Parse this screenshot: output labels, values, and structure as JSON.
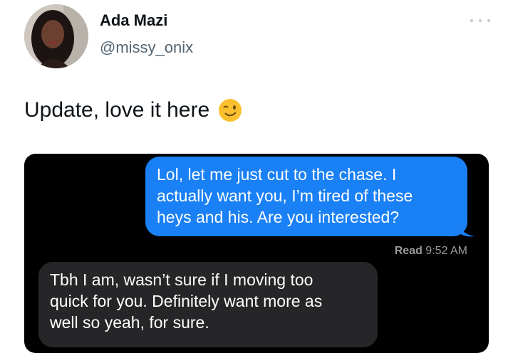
{
  "author": {
    "display_name": "Ada Mazi",
    "handle": "@missy_onix"
  },
  "tweet": {
    "text": "Update, love it here",
    "emoji": "winking-face"
  },
  "conversation": {
    "sent_message": {
      "lines": [
        "Lol, let me just cut to the chase. I",
        "actually want you, I’m tired of these",
        "heys and his. Are you interested?"
      ],
      "color": "#1a80f5"
    },
    "read_receipt": {
      "label": "Read",
      "time": "9:52 AM"
    },
    "received_message": {
      "lines": [
        "Tbh I am, wasn’t sure if I moving too",
        "quick for you. Definitely want more as",
        "well so yeah, for sure."
      ],
      "color": "#262628"
    }
  }
}
